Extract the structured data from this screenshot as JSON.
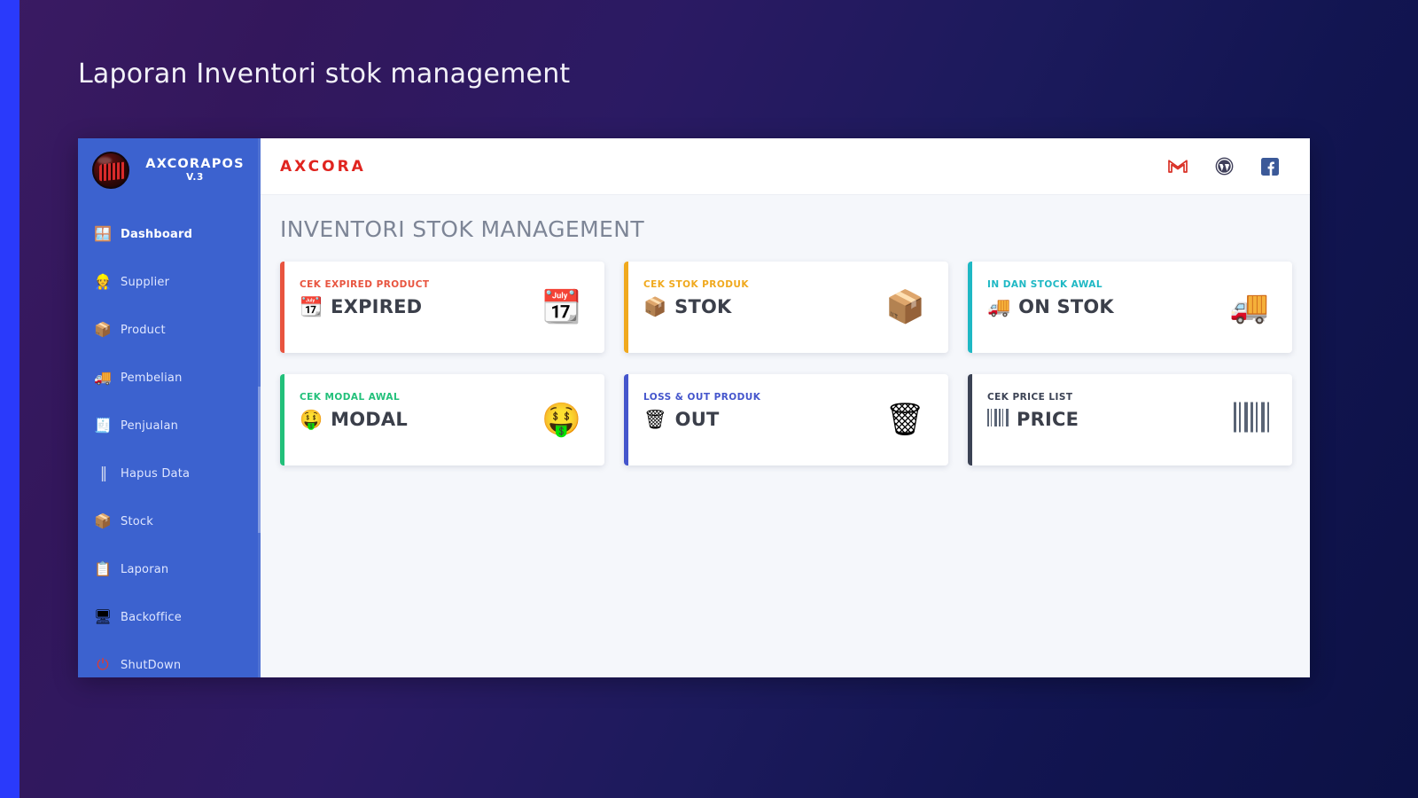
{
  "page": {
    "title": "Laporan Inventori stok management",
    "background_gradient_from": "#3a1b63",
    "background_gradient_to": "#0c1145",
    "accent_stripe_color": "#2a3afb"
  },
  "sidebar": {
    "brand": {
      "name": "AXCORAPOS",
      "version": "V.3",
      "logo_icon": "axcorapos-logo"
    },
    "items": [
      {
        "label": "Dashboard",
        "icon": "windows-icon",
        "glyph": "🪟",
        "active": true
      },
      {
        "label": "Supplier",
        "icon": "worker-icon",
        "glyph": "👷",
        "active": false
      },
      {
        "label": "Product",
        "icon": "package-icon",
        "glyph": "📦",
        "active": false
      },
      {
        "label": "Pembelian",
        "icon": "truck-icon",
        "glyph": "🚚",
        "active": false
      },
      {
        "label": "Penjualan",
        "icon": "register-icon",
        "glyph": "🧾",
        "active": false
      },
      {
        "label": "Hapus Data",
        "icon": "barcode-icon",
        "glyph": "‖",
        "active": false
      },
      {
        "label": "Stock",
        "icon": "box-icon",
        "glyph": "📦",
        "active": false
      },
      {
        "label": "Laporan",
        "icon": "clipboard-icon",
        "glyph": "📋",
        "active": false
      },
      {
        "label": "Backoffice",
        "icon": "monitor-icon",
        "glyph": "🖥",
        "active": false
      },
      {
        "label": "ShutDown",
        "icon": "power-icon",
        "glyph": "⏻",
        "active": false
      }
    ]
  },
  "topbar": {
    "logo_text": "AXCORA",
    "logo_color": "#e0241f",
    "icons": [
      {
        "name": "gmail-icon",
        "label": "M"
      },
      {
        "name": "wordpress-icon",
        "label": "W"
      },
      {
        "name": "facebook-icon",
        "label": "f"
      }
    ]
  },
  "content": {
    "heading": "INVENTORI STOK MANAGEMENT",
    "cards": [
      {
        "kicker": "CEK EXPIRED PRODUCT",
        "title": "EXPIRED",
        "accent": "#e8543f",
        "icon": "calendar-icon",
        "glyph": "📆"
      },
      {
        "kicker": "CEK STOK PRODUK",
        "title": "STOK",
        "accent": "#f0a91e",
        "icon": "box-icon",
        "glyph": "📦"
      },
      {
        "kicker": "IN DAN STOCK AWAL",
        "title": "ON STOK",
        "accent": "#1eb8c4",
        "icon": "truck-icon",
        "glyph": "🚚"
      },
      {
        "kicker": "CEK MODAL AWAL",
        "title": "MODAL",
        "accent": "#22c07a",
        "icon": "money-man-icon",
        "glyph": "🤑"
      },
      {
        "kicker": "LOSS & OUT PRODUK",
        "title": "OUT",
        "accent": "#4455cc",
        "icon": "trash-icon",
        "glyph": "🗑"
      },
      {
        "kicker": "CEK PRICE LIST",
        "title": "PRICE",
        "accent": "#3b4254",
        "icon": "barcode-icon",
        "glyph": "BARCODE"
      }
    ]
  }
}
